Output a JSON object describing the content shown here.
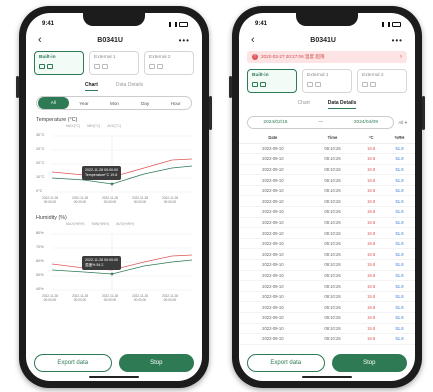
{
  "left": {
    "status_time": "9:41",
    "title": "B0341U",
    "sensors": [
      {
        "label": "Built-in",
        "active": true
      },
      {
        "label": "External 1",
        "active": false
      },
      {
        "label": "External 2",
        "active": false
      }
    ],
    "tabs": [
      "Chart",
      "Data Details"
    ],
    "range": [
      "All",
      "Year",
      "Mon",
      "Day",
      "Hour"
    ],
    "temp_chart": {
      "title": "Temperature (°C)",
      "legend": [
        "MAX(°C)",
        "MIN(°C)",
        "AVG(°C)"
      ],
      "yticks": [
        "30°C",
        "20°C",
        "20°C",
        "10°C",
        "0°C"
      ],
      "xticks": [
        "2022-11-28\n00:00:00",
        "2022-11-28\n00:00:00",
        "2022-11-28\n00:00:00",
        "2022-11-28\n00:00:00",
        "2022-11-28\n00:00:00"
      ],
      "tooltip_time": "2022-11-28 00:00:00",
      "tooltip_value": "Temperature°C   19.8"
    },
    "hum_chart": {
      "title": "Humidity (%)",
      "legend": [
        "MAX(%RH)",
        "MIN(%RH)",
        "AVG(%RH)"
      ],
      "yticks": [
        "80%",
        "70%",
        "60%",
        "50%",
        "40%"
      ],
      "xticks": [
        "2022-11-28\n00:00:00",
        "2022-11-28\n00:00:00",
        "2022-11-28\n00:00:00",
        "2022-11-28\n00:00:00",
        "2022-11-28\n00:00:00"
      ],
      "tooltip_time": "2022-11-28 00:00:00",
      "tooltip_value": "湿度%   54.2"
    },
    "buttons": {
      "export": "Export data",
      "stop": "Stop"
    }
  },
  "right": {
    "status_time": "9:41",
    "title": "B0341U",
    "alert": "2022-03-27 20:27:06  温度 超限",
    "sensors": [
      {
        "label": "Built-in",
        "active": true
      },
      {
        "label": "External 1",
        "active": false
      },
      {
        "label": "External 2",
        "active": false
      }
    ],
    "tabs": [
      "Chart",
      "Data Details"
    ],
    "date_start": "2024/02/16",
    "date_end": "2024/04/09",
    "date_sep": "—",
    "date_select": "All ▾",
    "table": {
      "headers": [
        "Date",
        "Time",
        "°C",
        "%RH"
      ],
      "rows": [
        [
          "2022-09-10",
          "09:10:26",
          "19.8",
          "51.8"
        ],
        [
          "2022-09-10",
          "09:10:26",
          "19.8",
          "51.8"
        ],
        [
          "2022-09-10",
          "09:10:26",
          "19.8",
          "51.8"
        ],
        [
          "2022-09-10",
          "09:10:26",
          "19.8",
          "51.8"
        ],
        [
          "2022-09-10",
          "09:10:26",
          "19.8",
          "51.8"
        ],
        [
          "2022-09-10",
          "09:10:26",
          "19.8",
          "51.8"
        ],
        [
          "2022-09-10",
          "09:10:26",
          "19.8",
          "51.8"
        ],
        [
          "2022-09-10",
          "09:10:26",
          "19.8",
          "51.8"
        ],
        [
          "2022-09-10",
          "09:10:26",
          "19.8",
          "51.8"
        ],
        [
          "2022-09-10",
          "09:10:26",
          "19.8",
          "51.8"
        ],
        [
          "2022-09-10",
          "09:10:26",
          "19.8",
          "51.8"
        ],
        [
          "2022-09-10",
          "09:10:26",
          "19.8",
          "51.8"
        ],
        [
          "2022-09-10",
          "09:10:26",
          "19.8",
          "51.8"
        ],
        [
          "2022-09-10",
          "09:10:26",
          "19.8",
          "51.8"
        ],
        [
          "2022-09-10",
          "09:10:26",
          "19.8",
          "51.8"
        ],
        [
          "2022-09-10",
          "09:10:26",
          "19.8",
          "51.8"
        ],
        [
          "2022-09-10",
          "09:10:26",
          "19.8",
          "51.8"
        ],
        [
          "2022-09-10",
          "09:10:26",
          "19.8",
          "51.8"
        ],
        [
          "2022-09-10",
          "09:10:26",
          "19.8",
          "51.8"
        ]
      ]
    },
    "buttons": {
      "export": "Export data",
      "stop": "Stop"
    }
  },
  "colors": {
    "accent": "#2d7a55",
    "alert": "#e05656",
    "humidity": "#3a7bd5"
  }
}
